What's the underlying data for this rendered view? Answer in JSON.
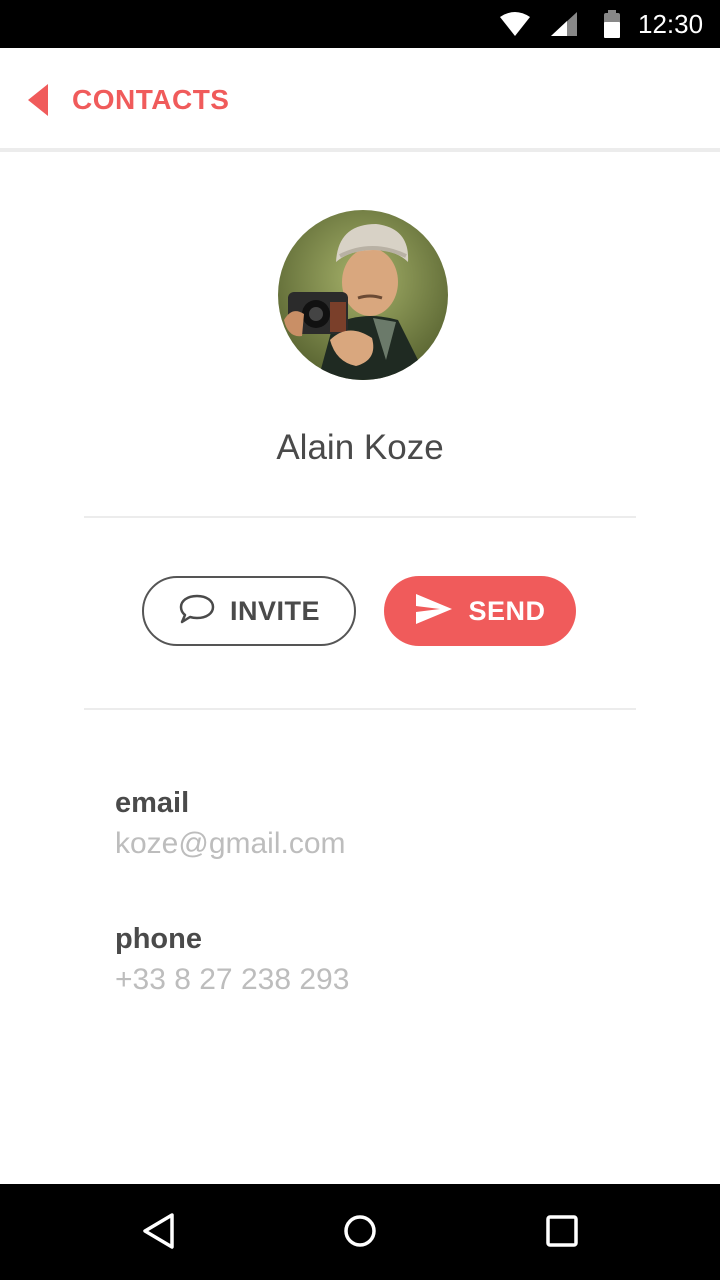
{
  "status_bar": {
    "time": "12:30",
    "icons": [
      "wifi-icon",
      "signal-icon",
      "battery-icon"
    ]
  },
  "header": {
    "back_label": "CONTACTS",
    "accent_color": "#f05b5b"
  },
  "contact": {
    "name": "Alain Koze",
    "avatar": "avatar-photo"
  },
  "actions": {
    "invite_label": "INVITE",
    "invite_icon": "speech-bubble-icon",
    "send_label": "SEND",
    "send_icon": "paper-plane-icon"
  },
  "fields": {
    "email_label": "email",
    "email_value": "koze@gmail.com",
    "phone_label": "phone",
    "phone_value": "+33 8 27 238 293"
  },
  "nav_bar": {
    "icons": [
      "nav-back-icon",
      "nav-home-icon",
      "nav-recents-icon"
    ]
  }
}
